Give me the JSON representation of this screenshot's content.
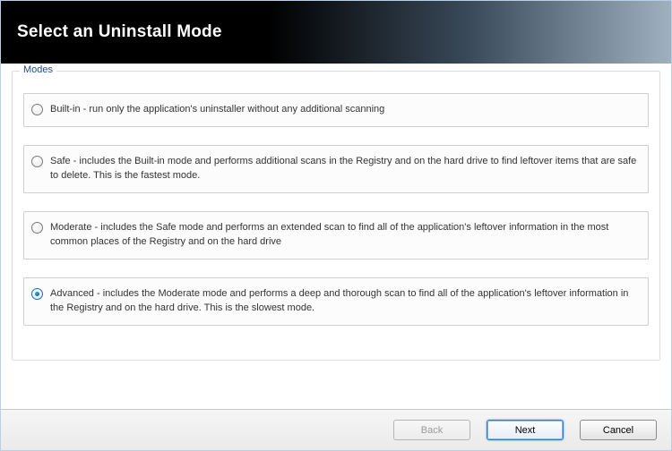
{
  "header": {
    "title": "Select an Uninstall Mode"
  },
  "group": {
    "label": "Modes"
  },
  "options": [
    {
      "id": "builtin",
      "label": "Built-in - run only the application's uninstaller without any additional scanning",
      "selected": false
    },
    {
      "id": "safe",
      "label": "Safe - includes the Built-in mode and performs additional scans in the Registry and on the hard drive to find leftover items that are safe to delete. This is the fastest mode.",
      "selected": false
    },
    {
      "id": "moderate",
      "label": "Moderate - includes the Safe mode and performs an extended scan to find all of the application's leftover information in the most common places of the Registry and on the hard drive",
      "selected": false
    },
    {
      "id": "advanced",
      "label": "Advanced - includes the Moderate mode and performs a deep and thorough scan to find all of the application's leftover information in the Registry and on the hard drive. This is the slowest mode.",
      "selected": true
    }
  ],
  "buttons": {
    "back": {
      "label": "Back",
      "enabled": false
    },
    "next": {
      "label": "Next",
      "enabled": true,
      "primary": true
    },
    "cancel": {
      "label": "Cancel",
      "enabled": true
    }
  }
}
